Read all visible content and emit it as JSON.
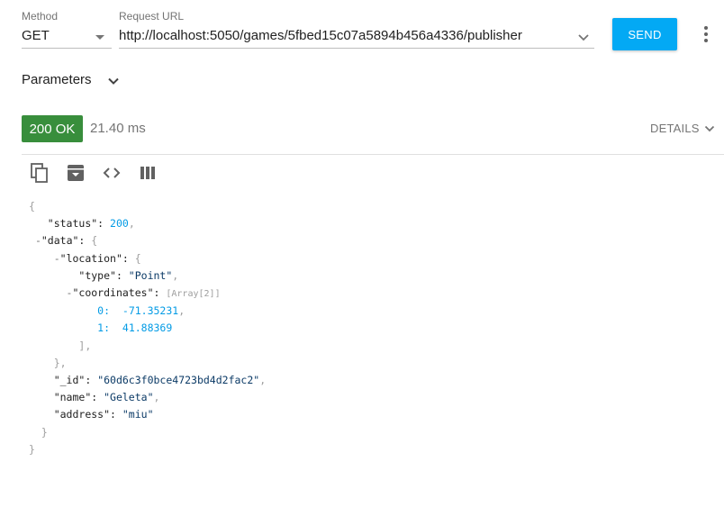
{
  "request": {
    "method_label": "Method",
    "method": "GET",
    "url_label": "Request URL",
    "url": "http://localhost:5050/games/5fbed15c07a5894b456a4336/publisher",
    "send_label": "SEND"
  },
  "parameters_label": "Parameters",
  "response": {
    "status": "200 OK",
    "time": "21.40 ms",
    "details_label": "DETAILS",
    "body": {
      "status_key": "\"status\"",
      "status_val": "200",
      "data_key": "\"data\"",
      "location_key": "\"location\"",
      "type_key": "\"type\"",
      "type_val": "\"Point\"",
      "coordinates_key": "\"coordinates\"",
      "coordinates_hint": "Array[2]",
      "coord0_idx": "0:",
      "coord0_val": "-71.35231",
      "coord1_idx": "1:",
      "coord1_val": "41.88369",
      "id_key": "\"_id\"",
      "id_val": "\"60d6c3f0bce4723bd4d2fac2\"",
      "name_key": "\"name\"",
      "name_val": "\"Geleta\"",
      "address_key": "\"address\"",
      "address_val": "\"miu\""
    }
  },
  "colors": {
    "send": "#03a9f4",
    "status_ok": "#388e3c",
    "json_string": "#0b3a66",
    "json_number": "#039be5"
  },
  "icons": [
    "copy-icon",
    "archive-download-icon",
    "code-icon",
    "columns-icon",
    "chevron-down-icon",
    "more-vert-icon"
  ]
}
